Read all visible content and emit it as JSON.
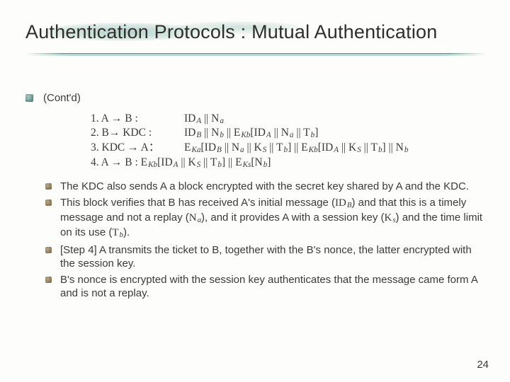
{
  "title": "Authentication Protocols : Mutual Authentication",
  "contd": "(Cont'd)",
  "steps": {
    "s1": {
      "left": "1. A → B :",
      "right_html": "ID<span class='sub'>A</span> || N<span class='sub'>a</span>"
    },
    "s2": {
      "left": "2. B→ KDC :",
      "right_html": "ID<span class='sub'>B</span> || N<span class='sub'>b</span> || E<span class='sub'>Kb</span>[ID<span class='sub'>A</span> || N<span class='sub'>a</span> || T<span class='sub'>b</span>]"
    },
    "s3": {
      "left": "3. KDC → A：",
      "right_html": "E<span class='sub'>Ka</span>[ID<span class='sub'>B</span> || N<span class='sub'>a</span> || K<span class='sub'>S</span> || T<span class='sub'>b</span>] || E<span class='sub'>Kb</span>[ID<span class='sub'>A</span> || K<span class='sub'>S</span> || T<span class='sub'>b</span>] || N<span class='sub'>b</span>"
    },
    "s4_html": "4. A → B : E<span class='sub'>Kb</span>[ID<span class='sub'>A</span> || K<span class='sub'>S</span> || T<span class='sub'>b</span>] || E<span class='sub'>Ks</span>[N<span class='sub'>b</span>]"
  },
  "bullets": {
    "b1": "The KDC also sends A a block encrypted with the secret key shared by A and the KDC.",
    "b2_html": "This block verifies that B has received A's initial message (<span class='serif'>ID<span class='sub'>B</span></span>) and that this is a timely message and not a replay (<span class='serif'>N<span class='sub'>a</span></span>), and it provides A with a session key (<span class='serif'>K<span class='sub'>s</span></span>) and the time limit on its use (<span class='serif'>T<span class='sub'>b</span></span>).",
    "b3": "[Step 4] A transmits the ticket to B, together with the B's nonce, the latter encrypted with the session key.",
    "b4": "B's nonce is encrypted with the session key authenticates that the message came form A and is not a replay."
  },
  "page_number": "24"
}
